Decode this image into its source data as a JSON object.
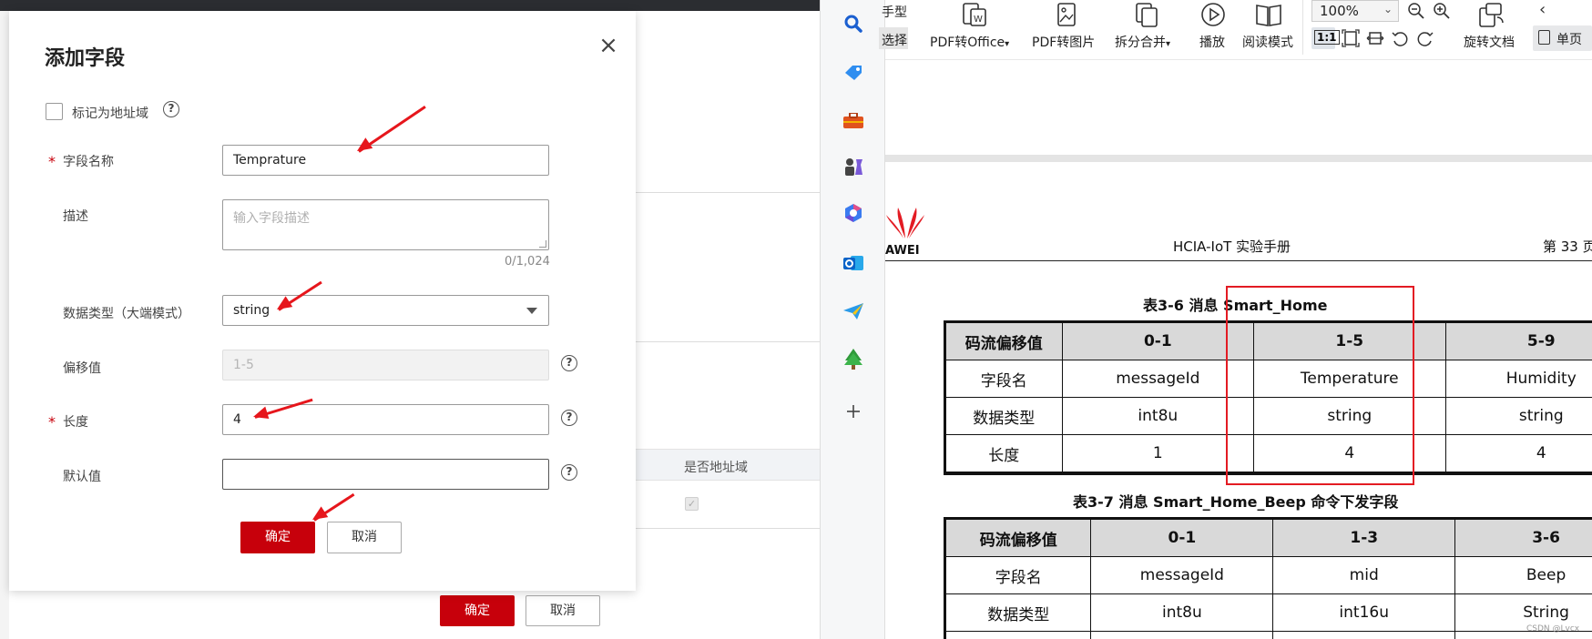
{
  "dialog": {
    "title": "添加字段",
    "close_symbol": "×",
    "mark_address_label": "标记为地址域",
    "help_symbol": "?",
    "required_symbol": "*",
    "fields": {
      "name": {
        "label": "字段名称",
        "value": "Temprature"
      },
      "description": {
        "label": "描述",
        "placeholder": "输入字段描述",
        "counter": "0/1,024"
      },
      "data_type": {
        "label": "数据类型（大端模式）",
        "value": "string"
      },
      "offset": {
        "label": "偏移值",
        "value": "1-5"
      },
      "length": {
        "label": "长度",
        "value": "4"
      },
      "default": {
        "label": "默认值",
        "value": ""
      }
    },
    "confirm_label": "确定",
    "cancel_label": "取消"
  },
  "background_console": {
    "column_header": "是否地址域",
    "confirm_label": "确定",
    "cancel_label": "取消"
  },
  "pdf_toolbar": {
    "partial_top_1": "手型",
    "partial_top_2": "选择",
    "pdf_to_office": "PDF转Office",
    "pdf_to_image": "PDF转图片",
    "split_merge": "拆分合并",
    "play": "播放",
    "reading_mode": "阅读模式",
    "zoom_value": "100%",
    "actual_size": "1:1",
    "rotate_doc": "旋转文档",
    "single_page": "单页",
    "dropdown_symbol": "▾"
  },
  "pdf_document": {
    "logo_text": "AWEI",
    "header_title": "HCIA-IoT 实验手册",
    "page_label": "第 33 页",
    "table1": {
      "caption": "表3-6 消息 Smart_Home",
      "header": [
        "码流偏移值",
        "0-1",
        "1-5",
        "5-9"
      ],
      "rows": [
        [
          "字段名",
          "messageId",
          "Temperature",
          "Humidity"
        ],
        [
          "数据类型",
          "int8u",
          "string",
          "string"
        ],
        [
          "长度",
          "1",
          "4",
          "4"
        ]
      ]
    },
    "table2": {
      "caption": "表3-7 消息 Smart_Home_Beep 命令下发字段",
      "header": [
        "码流偏移值",
        "0-1",
        "1-3",
        "3-6"
      ],
      "rows": [
        [
          "字段名",
          "messageId",
          "mid",
          "Beep"
        ],
        [
          "数据类型",
          "int8u",
          "int16u",
          "String"
        ]
      ]
    },
    "watermark": "CSDN @Lvcx"
  },
  "colors": {
    "primary_red": "#c7000b",
    "annotation_red": "#e6161c"
  }
}
